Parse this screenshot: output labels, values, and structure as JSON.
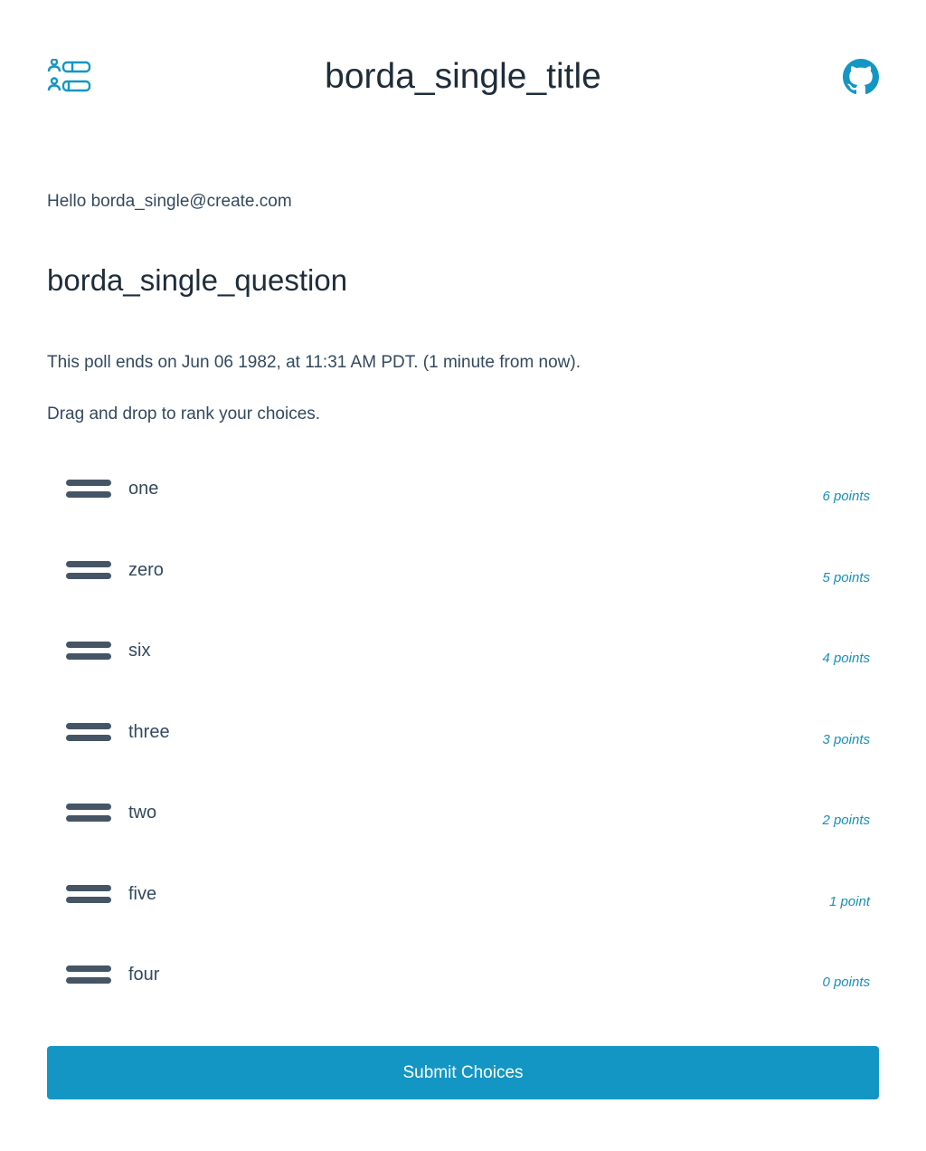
{
  "header": {
    "title": "borda_single_title",
    "logo_icon": "poll-list-icon",
    "github_icon": "github-icon",
    "accent_color": "#1496c4"
  },
  "greeting": "Hello borda_single@create.com",
  "poll": {
    "question": "borda_single_question",
    "end_notice": "This poll ends on Jun 06 1982, at 11:31 AM PDT. (1 minute from now).",
    "instructions": "Drag and drop to rank your choices.",
    "choices": [
      {
        "label": "one",
        "points": "6 points"
      },
      {
        "label": "zero",
        "points": "5 points"
      },
      {
        "label": "six",
        "points": "4 points"
      },
      {
        "label": "three",
        "points": "3 points"
      },
      {
        "label": "two",
        "points": "2 points"
      },
      {
        "label": "five",
        "points": "1 point"
      },
      {
        "label": "four",
        "points": "0 points"
      }
    ]
  },
  "submit_label": "Submit Choices"
}
